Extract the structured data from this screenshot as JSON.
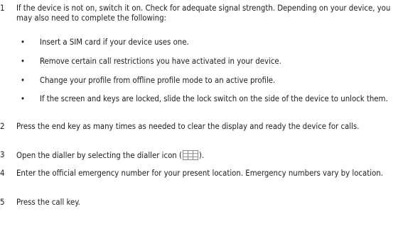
{
  "steps": [
    {
      "number": "1",
      "text": "If the device is not on, switch it on. Check for adequate signal strength. Depending on your device, you may also need to complete the following:",
      "bullets": [
        "Insert a SIM card if your device uses one.",
        "Remove certain call restrictions you have activated in your device.",
        "Change your profile from offline profile mode to an active profile.",
        "If the screen and keys are locked, slide the lock switch on the side of the device to unlock them."
      ]
    },
    {
      "number": "2",
      "text": "Press the end key as many times as needed to clear the display and ready the device for calls."
    },
    {
      "number": "3",
      "text_before_icon": "Open the dialler by selecting the dialler icon (",
      "icon": "dialler-icon",
      "text_after_icon": ")."
    },
    {
      "number": "4",
      "text": "Enter the official emergency number for your present location. Emergency numbers vary by location."
    },
    {
      "number": "5",
      "text": "Press the call key."
    }
  ]
}
